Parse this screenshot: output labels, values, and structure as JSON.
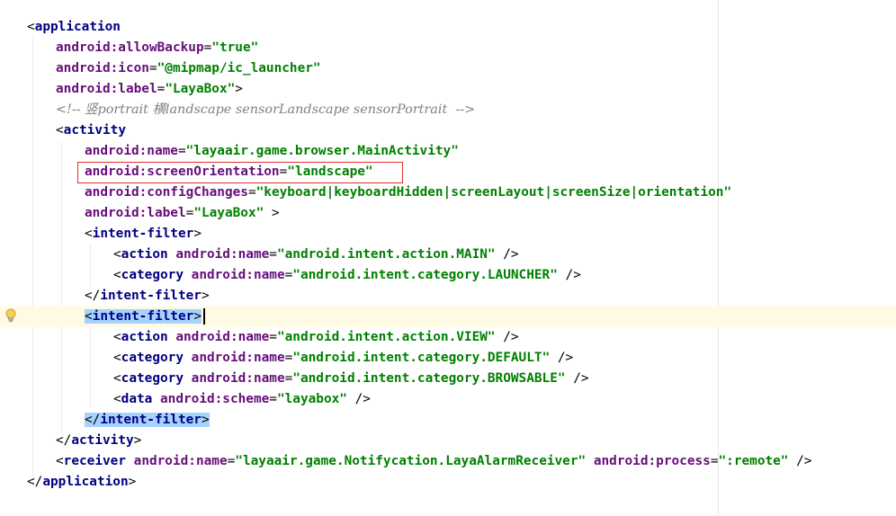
{
  "editor": {
    "lines": [
      {
        "id": "l1",
        "segments": [
          [
            "ang",
            "<"
          ],
          [
            "tag",
            "application"
          ]
        ]
      },
      {
        "id": "l2",
        "segments": [
          [
            "attr",
            "android:allowBackup"
          ],
          [
            "eq",
            "="
          ],
          [
            "val",
            "\"true\""
          ]
        ]
      },
      {
        "id": "l3",
        "segments": [
          [
            "attr",
            "android:icon"
          ],
          [
            "eq",
            "="
          ],
          [
            "val",
            "\"@mipmap/ic_launcher\""
          ]
        ]
      },
      {
        "id": "l4",
        "segments": [
          [
            "attr",
            "android:label"
          ],
          [
            "eq",
            "="
          ],
          [
            "val",
            "\"LayaBox\""
          ],
          [
            "ang",
            ">"
          ]
        ]
      },
      {
        "id": "l5",
        "segments": [
          [
            "comment",
            "<!-- 竖portrait 横landscape sensorLandscape sensorPortrait  -->"
          ]
        ]
      },
      {
        "id": "l6",
        "segments": [
          [
            "ang",
            "<"
          ],
          [
            "tag",
            "activity"
          ]
        ]
      },
      {
        "id": "l7",
        "segments": [
          [
            "attr",
            "android:name"
          ],
          [
            "eq",
            "="
          ],
          [
            "val",
            "\"layaair.game.browser.MainActivity\""
          ]
        ]
      },
      {
        "id": "l8",
        "segments": [
          [
            "attr",
            "android:screenOrientation"
          ],
          [
            "eq",
            "="
          ],
          [
            "val",
            "\"landscape\""
          ]
        ]
      },
      {
        "id": "l9",
        "segments": [
          [
            "attr",
            "android:configChanges"
          ],
          [
            "eq",
            "="
          ],
          [
            "val",
            "\"keyboard|keyboardHidden|screenLayout|screenSize|orientation\""
          ]
        ]
      },
      {
        "id": "l10",
        "segments": [
          [
            "attr",
            "android:label"
          ],
          [
            "eq",
            "="
          ],
          [
            "val",
            "\"LayaBox\""
          ],
          [
            "ang",
            " >"
          ]
        ]
      },
      {
        "id": "l11",
        "segments": [
          [
            "ang",
            "<"
          ],
          [
            "tag",
            "intent-filter"
          ],
          [
            "ang",
            ">"
          ]
        ]
      },
      {
        "id": "l12",
        "segments": [
          [
            "ang",
            "<"
          ],
          [
            "tag",
            "action "
          ],
          [
            "attr",
            "android:name"
          ],
          [
            "eq",
            "="
          ],
          [
            "val",
            "\"android.intent.action.MAIN\""
          ],
          [
            "ang",
            " />"
          ]
        ]
      },
      {
        "id": "l13",
        "segments": [
          [
            "ang",
            "<"
          ],
          [
            "tag",
            "category "
          ],
          [
            "attr",
            "android:name"
          ],
          [
            "eq",
            "="
          ],
          [
            "val",
            "\"android.intent.category.LAUNCHER\""
          ],
          [
            "ang",
            " />"
          ]
        ]
      },
      {
        "id": "l14",
        "segments": [
          [
            "ang",
            "</"
          ],
          [
            "tag",
            "intent-filter"
          ],
          [
            "ang",
            ">"
          ]
        ]
      },
      {
        "id": "l15",
        "segments": [
          [
            "hlang",
            "<"
          ],
          [
            "hltag",
            "intent-filter"
          ],
          [
            "hlang",
            ">"
          ]
        ]
      },
      {
        "id": "l16",
        "segments": [
          [
            "ang",
            "<"
          ],
          [
            "tag",
            "action "
          ],
          [
            "attr",
            "android:name"
          ],
          [
            "eq",
            "="
          ],
          [
            "val",
            "\"android.intent.action.VIEW\""
          ],
          [
            "ang",
            " />"
          ]
        ]
      },
      {
        "id": "l17",
        "segments": [
          [
            "ang",
            "<"
          ],
          [
            "tag",
            "category "
          ],
          [
            "attr",
            "android:name"
          ],
          [
            "eq",
            "="
          ],
          [
            "val",
            "\"android.intent.category.DEFAULT\""
          ],
          [
            "ang",
            " />"
          ]
        ]
      },
      {
        "id": "l18",
        "segments": [
          [
            "ang",
            "<"
          ],
          [
            "tag",
            "category "
          ],
          [
            "attr",
            "android:name"
          ],
          [
            "eq",
            "="
          ],
          [
            "val",
            "\"android.intent.category.BROWSABLE\""
          ],
          [
            "ang",
            " />"
          ]
        ]
      },
      {
        "id": "l19",
        "segments": [
          [
            "ang",
            "<"
          ],
          [
            "tag",
            "data "
          ],
          [
            "attr",
            "android:scheme"
          ],
          [
            "eq",
            "="
          ],
          [
            "val",
            "\"layabox\""
          ],
          [
            "ang",
            " />"
          ]
        ]
      },
      {
        "id": "l20",
        "segments": [
          [
            "hlang",
            "</"
          ],
          [
            "hltag",
            "intent-filter"
          ],
          [
            "hlang",
            ">"
          ]
        ]
      },
      {
        "id": "l21",
        "segments": [
          [
            "ang",
            "</"
          ],
          [
            "tag",
            "activity"
          ],
          [
            "ang",
            ">"
          ]
        ]
      },
      {
        "id": "l22",
        "segments": [
          [
            "ang",
            "<"
          ],
          [
            "tag",
            "receiver "
          ],
          [
            "attr",
            "android:name"
          ],
          [
            "eq",
            "="
          ],
          [
            "val",
            "\"layaair.game.Notifycation.LayaAlarmReceiver\""
          ],
          [
            "ang",
            " "
          ],
          [
            "attr",
            "android:process"
          ],
          [
            "eq",
            "="
          ],
          [
            "val",
            "\":remote\""
          ],
          [
            "ang",
            " />"
          ]
        ]
      },
      {
        "id": "l23",
        "segments": [
          [
            "ang",
            "</"
          ],
          [
            "tag",
            "application"
          ],
          [
            "ang",
            ">"
          ]
        ]
      }
    ]
  },
  "colors": {
    "tag": "#000080",
    "attribute": "#660e7a",
    "value": "#008000",
    "comment": "#808080",
    "selection": "#a6d2ff",
    "caret_row": "#fffae3",
    "annotation_box": "#e0302a"
  },
  "icons": {
    "gutter": "lightbulb-icon"
  }
}
